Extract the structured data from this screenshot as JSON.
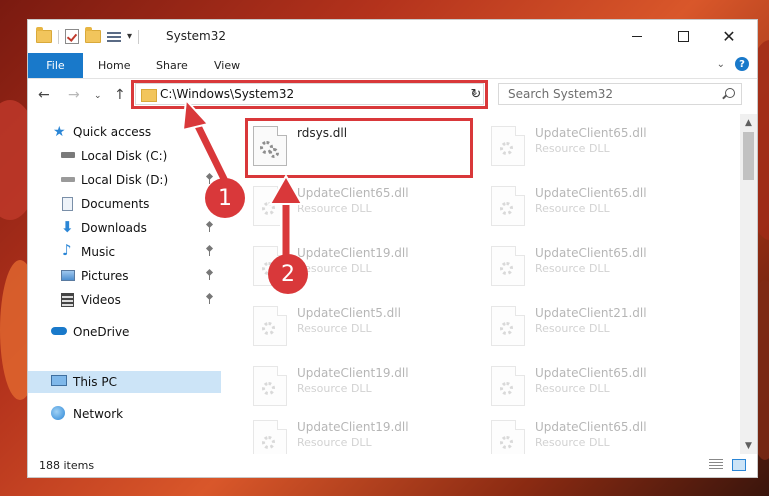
{
  "window": {
    "title": "System32"
  },
  "ribbon": {
    "tabs": [
      "File",
      "Home",
      "Share",
      "View"
    ]
  },
  "address": {
    "path": "C:\\Windows\\System32"
  },
  "search": {
    "placeholder": "Search System32"
  },
  "sidebar": {
    "items": [
      {
        "label": "Quick access",
        "icon": "star-icon",
        "pinned": false
      },
      {
        "label": "Local Disk (C:)",
        "icon": "drive-icon",
        "pinned": false
      },
      {
        "label": "Local Disk (D:)",
        "icon": "drive-icon",
        "pinned": true
      },
      {
        "label": "Documents",
        "icon": "documents-icon",
        "pinned": true
      },
      {
        "label": "Downloads",
        "icon": "downloads-icon",
        "pinned": true
      },
      {
        "label": "Music",
        "icon": "music-icon",
        "pinned": true
      },
      {
        "label": "Pictures",
        "icon": "pictures-icon",
        "pinned": true
      },
      {
        "label": "Videos",
        "icon": "videos-icon",
        "pinned": true
      },
      {
        "label": "OneDrive",
        "icon": "onedrive-icon",
        "pinned": false
      },
      {
        "label": "This PC",
        "icon": "this-pc-icon",
        "pinned": false,
        "selected": true
      },
      {
        "label": "Network",
        "icon": "network-icon",
        "pinned": false
      }
    ]
  },
  "files": [
    {
      "name": "rdsys.dll",
      "type": ""
    },
    {
      "name": "UpdateClient65.dll",
      "type": "Resource DLL"
    },
    {
      "name": "UpdateClient65.dll",
      "type": "Resource DLL"
    },
    {
      "name": "UpdateClient65.dll",
      "type": "Resource DLL"
    },
    {
      "name": "UpdateClient19.dll",
      "type": "Resource DLL"
    },
    {
      "name": "UpdateClient65.dll",
      "type": "Resource DLL"
    },
    {
      "name": "UpdateClient5.dll",
      "type": "Resource DLL"
    },
    {
      "name": "UpdateClient21.dll",
      "type": "Resource DLL"
    },
    {
      "name": "UpdateClient19.dll",
      "type": "Resource DLL"
    },
    {
      "name": "UpdateClient65.dll",
      "type": "Resource DLL"
    },
    {
      "name": "UpdateClient19.dll",
      "type": "Resource DLL"
    },
    {
      "name": "UpdateClient65.dll",
      "type": "Resource DLL"
    }
  ],
  "status": {
    "item_count": "188 items"
  },
  "callouts": [
    "1",
    "2"
  ],
  "colors": {
    "accent": "#1979ca",
    "highlight": "#d9383a",
    "selected": "#cce4f7"
  }
}
